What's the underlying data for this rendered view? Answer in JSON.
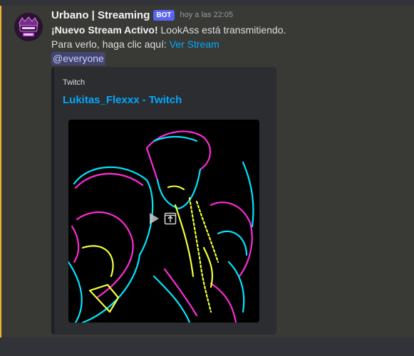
{
  "message": {
    "author": "Urbano | Streaming",
    "bot_tag": "BOT",
    "timestamp": "hoy a las 22:05",
    "line1_bold": "¡Nuevo Stream Activo!",
    "line1_rest": " LookAss está transmitiendo.",
    "line2_text": "Para verlo, haga clic aquí: ",
    "line2_link": "Ver Stream",
    "mention": "@everyone"
  },
  "embed": {
    "provider": "Twitch",
    "title": "Lukitas_Flexxx - Twitch",
    "media_controls": [
      "play-icon",
      "open-external-icon"
    ]
  },
  "colors": {
    "message_highlight": "#393a35",
    "mention_bar": "#f0b232",
    "link": "#00a8fc",
    "bot_tag": "#5865f2",
    "embed_bg": "#2b2d31"
  }
}
